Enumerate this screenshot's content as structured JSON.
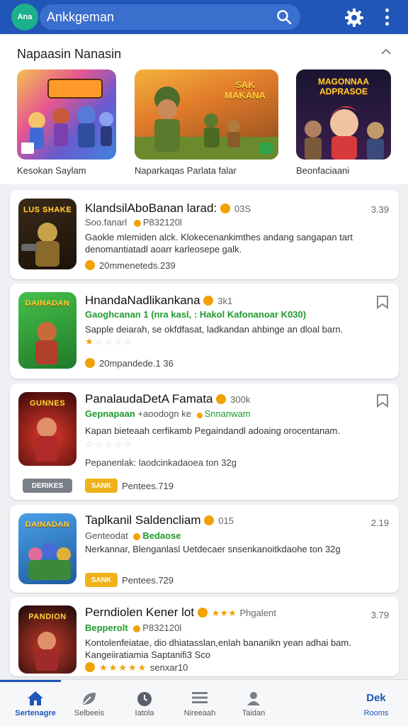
{
  "app": {
    "logo_text": "Ana"
  },
  "search": {
    "value": "Ankkgeman"
  },
  "featured": {
    "title": "Napaasin Nanasin",
    "items": [
      {
        "caption": "Kesokan Saylam"
      },
      {
        "caption": "Naparkaqas Parlata falar",
        "image_title": "SAK MAKANA"
      },
      {
        "caption": "Beonfaciaani",
        "image_title": "MAGONNAA ADPRASOE"
      }
    ]
  },
  "list": [
    {
      "thumb_title": "LUS SHAKE",
      "name": "KlandsilAboBanan larad:",
      "badge": "03S",
      "right": "3.39",
      "sub": "Soo.fanarl",
      "sub2": "P832120l",
      "desc": "Gaokle mlemiden alck.  Klokecenankimthes andang sangapan tart denomantiatadl aoarr karleosepe galk.",
      "foot": "20mmeneteds.239"
    },
    {
      "thumb_title": "DAINADAN",
      "name": "HnandaNadlikankana",
      "badge": "3k1",
      "sub": "Gaoghcanan  1 (nra kasl,  :  Hakol Kafonanoar  K030)",
      "desc": "Sapple deiarah, se okfdfasat, ladkandan ahbinge an dloal barn.",
      "foot": "20mpandede.1 36"
    },
    {
      "thumb_title": "GUNNES",
      "name": "PanalaudaDetA Famata",
      "badge": "300k",
      "sub": "Gepnapaan",
      "sub2": "+aoodogn ke",
      "sub3": "Snnanwam",
      "desc": "Kapan bieteaah cerfikamb Pegaindandl adoaing orocentanam.",
      "foot": "Pepanenlak:  laodcinkadaoea  ton 32g",
      "pill1": "DERIKES",
      "pill2": "SANK",
      "foot2": "Pentees.719"
    },
    {
      "thumb_title": "DAINADAN",
      "name": "Taplkanil Saldencliam",
      "badge": "015",
      "right": "2.19",
      "sub": "Genteodat",
      "sub2": "Bedaose",
      "desc": "Nerkannar, Blenganlasl Uetdecaer snsenkanoitkdaohe ton 32g",
      "pill": "SANK",
      "foot": "Pentees.729"
    },
    {
      "thumb_title": "PANDION",
      "name": "Perndiolen Kener lot",
      "badge": "Phgalent",
      "right": "3.79",
      "sub": "Bepperolt",
      "sub2": "P832120l",
      "desc": "Kontolenfeiatae, dio dhiatasslan,enlah bananikn yean adhai bam. Kangeiiratiamia Saptanifi3 Sco",
      "foot": "senxar10"
    }
  ],
  "bottom_nav": [
    {
      "label": "Sertenagre"
    },
    {
      "label": "Selbeeis"
    },
    {
      "label": "Iatola"
    },
    {
      "label": "Nireeaah"
    },
    {
      "label": "Taidan"
    },
    {
      "label": "Rooms",
      "top": "Dek"
    }
  ]
}
